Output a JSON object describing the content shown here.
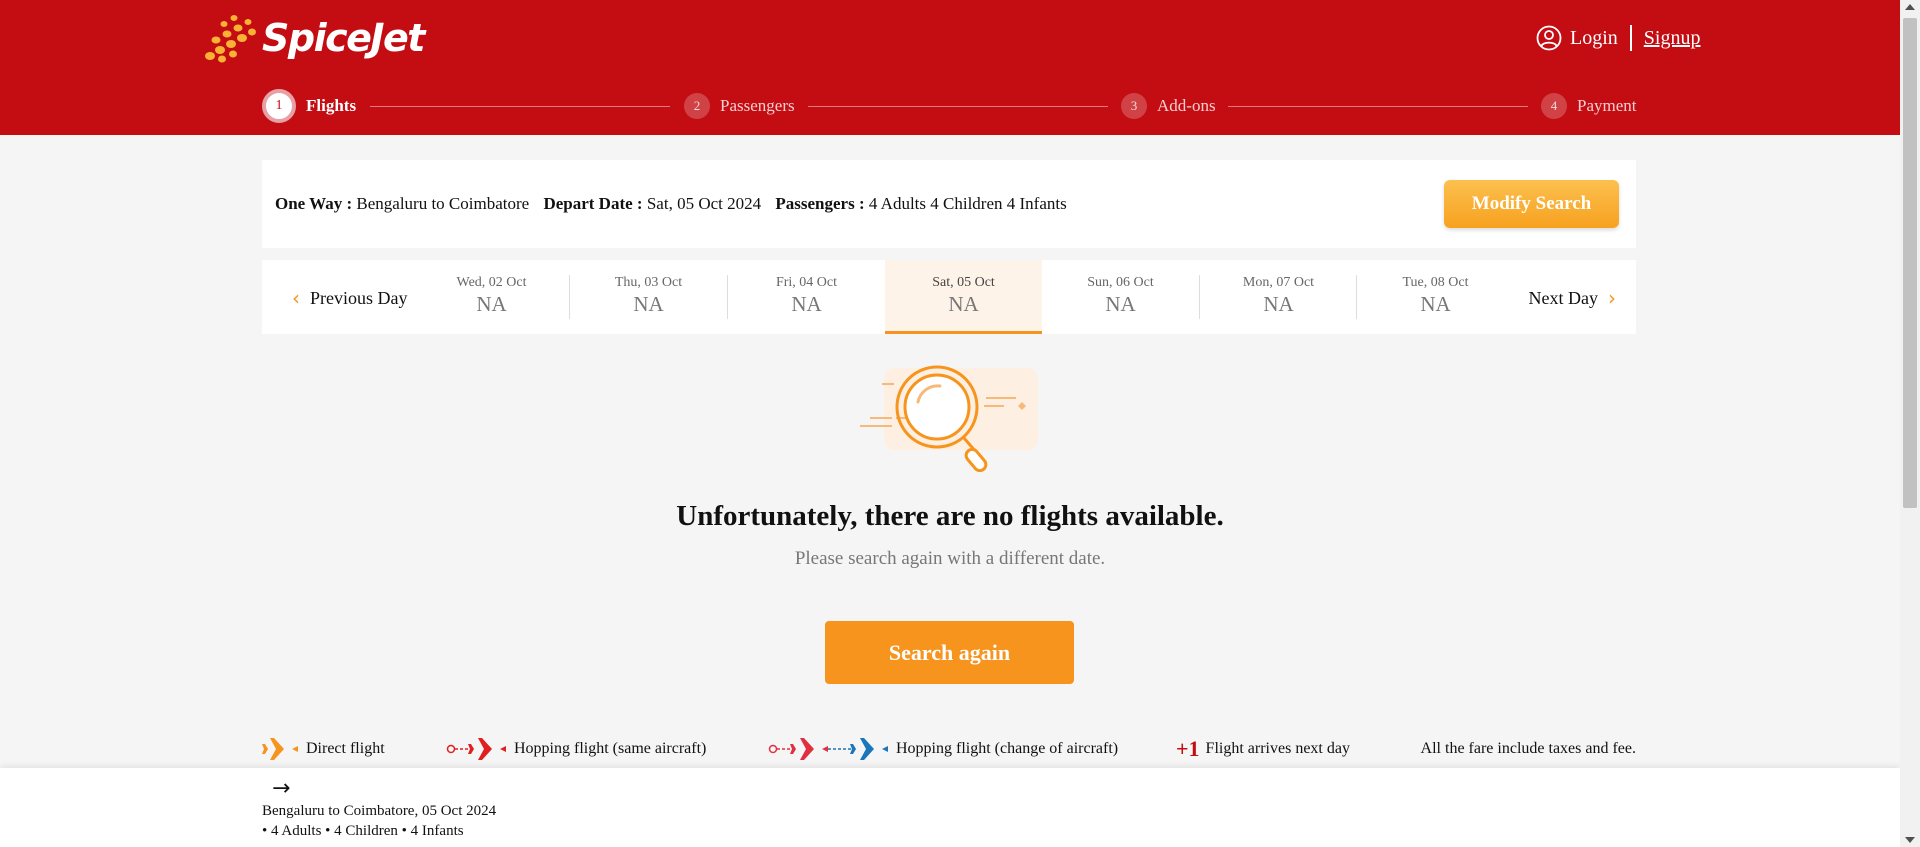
{
  "brand": {
    "name": "SpiceJet",
    "primary_color": "#c40d13",
    "accent_color": "#f7941d"
  },
  "auth": {
    "login": "Login",
    "signup": "Signup"
  },
  "stepper": [
    {
      "num": "1",
      "label": "Flights",
      "active": true
    },
    {
      "num": "2",
      "label": "Passengers",
      "active": false
    },
    {
      "num": "3",
      "label": "Add-ons",
      "active": false
    },
    {
      "num": "4",
      "label": "Payment",
      "active": false
    }
  ],
  "summary": {
    "trip_label": "One Way :",
    "route": "Bengaluru to Coimbatore",
    "depart_label": "Depart Date :",
    "depart_value": "Sat, 05 Oct 2024",
    "pax_label": "Passengers :",
    "pax_value": "4 Adults 4 Children 4 Infants",
    "modify_button": "Modify Search"
  },
  "date_strip": {
    "prev": "Previous Day",
    "next": "Next Day",
    "days": [
      {
        "date": "Wed, 02 Oct",
        "price": "NA",
        "selected": false
      },
      {
        "date": "Thu, 03 Oct",
        "price": "NA",
        "selected": false
      },
      {
        "date": "Fri, 04 Oct",
        "price": "NA",
        "selected": false
      },
      {
        "date": "Sat, 05 Oct",
        "price": "NA",
        "selected": true
      },
      {
        "date": "Sun, 06 Oct",
        "price": "NA",
        "selected": false
      },
      {
        "date": "Mon, 07 Oct",
        "price": "NA",
        "selected": false
      },
      {
        "date": "Tue, 08 Oct",
        "price": "NA",
        "selected": false
      }
    ]
  },
  "empty_state": {
    "title": "Unfortunately, there are no flights available.",
    "subtitle": "Please search again with a different date.",
    "button": "Search again"
  },
  "legend": {
    "direct": "Direct flight",
    "hop_same": "Hopping flight (same aircraft)",
    "hop_change": "Hopping flight (change of aircraft)",
    "plus_one": "+1",
    "next_day": "Flight arrives next day",
    "fare_note": "All the fare include taxes and fee."
  },
  "bottom_bar": {
    "arrow": "→",
    "route_date": "Bengaluru to Coimbatore, 05 Oct 2024",
    "pax": "• 4 Adults • 4 Children • 4 Infants"
  }
}
